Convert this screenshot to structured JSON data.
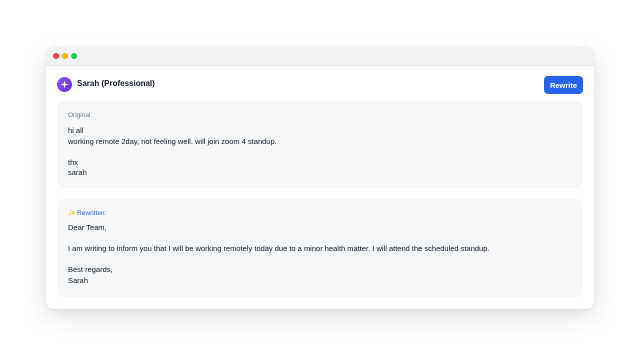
{
  "window": {
    "controls": [
      "close",
      "minimize",
      "maximize"
    ]
  },
  "header": {
    "avatar_icon": "sparkle-icon",
    "persona_label": "Sarah (Professional)",
    "rewrite_label": "Rewrite"
  },
  "original": {
    "label": "Original:",
    "text": "hi all\nworking remote 2day, not feeling well. will join zoom 4 standup.\n\nthx\nsarah"
  },
  "rewritten": {
    "label_icon": "✨",
    "label": "Rewritten:",
    "text": "Dear Team,\n\nI am writing to inform you that I will be working remotely today due to a minor health matter. I will attend the scheduled standup.\n\nBest regards,\nSarah"
  },
  "colors": {
    "accent": "#2563eb",
    "avatar": "#7c3aed",
    "panel_bg": "#f7f8fa"
  }
}
